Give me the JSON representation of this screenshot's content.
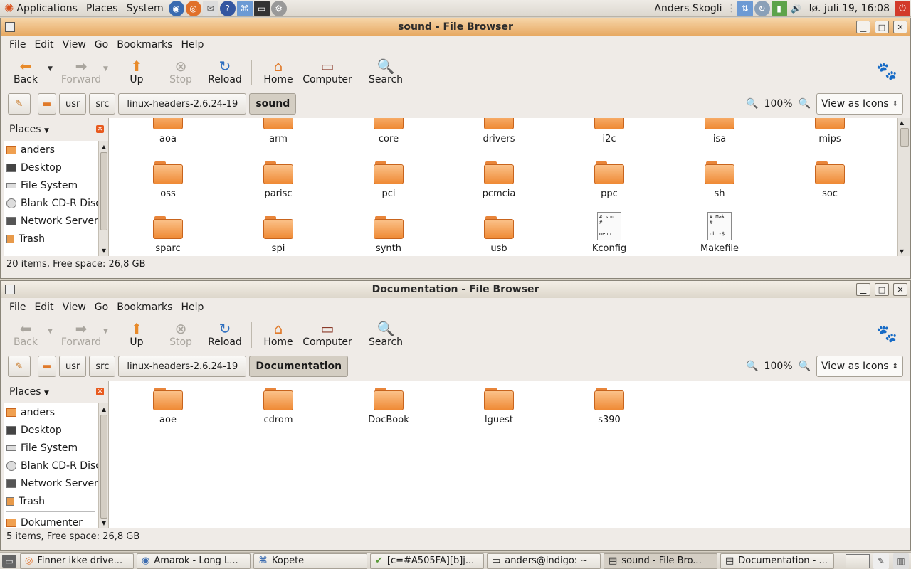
{
  "top_panel": {
    "menus": [
      "Applications",
      "Places",
      "System"
    ],
    "user": "Anders Skogli",
    "clock": "lø. juli 19, 16:08"
  },
  "windows": [
    {
      "title": "sound - File Browser",
      "menu": [
        "File",
        "Edit",
        "View",
        "Go",
        "Bookmarks",
        "Help"
      ],
      "toolbar": {
        "back": "Back",
        "forward": "Forward",
        "up": "Up",
        "stop": "Stop",
        "reload": "Reload",
        "home": "Home",
        "computer": "Computer",
        "search": "Search"
      },
      "path": [
        "usr",
        "src",
        "linux-headers-2.6.24-19",
        "sound"
      ],
      "zoom": "100%",
      "view_mode": "View as Icons",
      "places_label": "Places",
      "places": [
        "anders",
        "Desktop",
        "File System",
        "Blank CD-R Disc",
        "Network Servers",
        "Trash"
      ],
      "items": [
        "aoa",
        "arm",
        "core",
        "drivers",
        "i2c",
        "isa",
        "mips",
        "oss",
        "parisc",
        "pci",
        "pcmcia",
        "ppc",
        "sh",
        "soc",
        "sparc",
        "spi",
        "synth",
        "usb",
        "Kconfig",
        "Makefile"
      ],
      "file_previews": {
        "Kconfig": "# sou\n#\n\nmenu",
        "Makefile": "# Mak\n#\n\nobi-$"
      },
      "status": "20 items, Free space: 26,8 GB"
    },
    {
      "title": "Documentation - File Browser",
      "menu": [
        "File",
        "Edit",
        "View",
        "Go",
        "Bookmarks",
        "Help"
      ],
      "toolbar": {
        "back": "Back",
        "forward": "Forward",
        "up": "Up",
        "stop": "Stop",
        "reload": "Reload",
        "home": "Home",
        "computer": "Computer",
        "search": "Search"
      },
      "path": [
        "usr",
        "src",
        "linux-headers-2.6.24-19",
        "Documentation"
      ],
      "zoom": "100%",
      "view_mode": "View as Icons",
      "places_label": "Places",
      "places": [
        "anders",
        "Desktop",
        "File System",
        "Blank CD-R Disc",
        "Network Servers",
        "Trash",
        "Dokumenter"
      ],
      "items": [
        "aoe",
        "cdrom",
        "DocBook",
        "lguest",
        "s390"
      ],
      "status": "5 items, Free space: 26,8 GB"
    }
  ],
  "taskbar": [
    "Finner ikke drive...",
    "Amarok - Long L...",
    "Kopete",
    "[c=#A505FA][b]j...",
    "anders@indigo: ~",
    "sound - File Bro...",
    "Documentation - ..."
  ],
  "colors": {
    "folder": "#ef8a35",
    "active_title": "#e7a963",
    "panel": "#dcd7ce"
  }
}
